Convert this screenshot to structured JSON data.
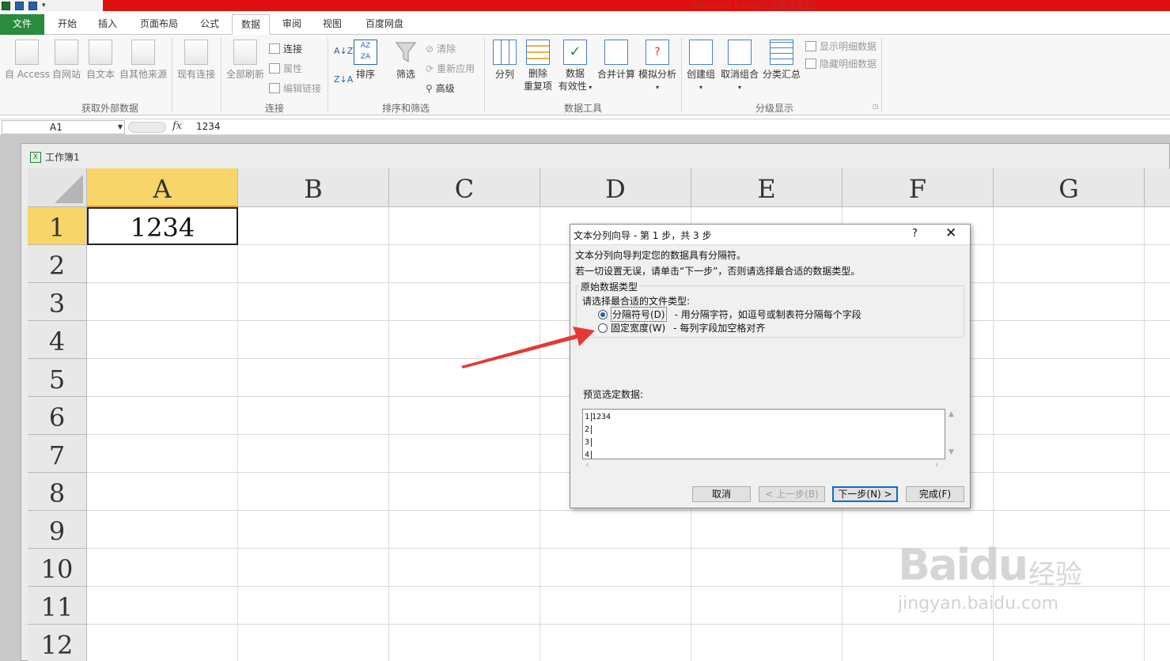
{
  "window": {
    "title": "Microsoft Excel(产品激活失败)"
  },
  "tabs": [
    {
      "label": "文件"
    },
    {
      "label": "开始"
    },
    {
      "label": "插入"
    },
    {
      "label": "页面布局"
    },
    {
      "label": "公式"
    },
    {
      "label": "数据"
    },
    {
      "label": "审阅"
    },
    {
      "label": "视图"
    },
    {
      "label": "百度网盘"
    }
  ],
  "ribbon": {
    "external": {
      "access": "自 Access",
      "web": "自网站",
      "text": "自文本",
      "other": "自其他来源",
      "existing": "现有连接",
      "group": "获取外部数据"
    },
    "connections": {
      "refresh_all": "全部刷新",
      "connections": "连接",
      "properties": "属性",
      "edit_links": "编辑链接",
      "group": "连接"
    },
    "sort_filter": {
      "sort": "排序",
      "filter": "筛选",
      "clear": "清除",
      "reapply": "重新应用",
      "advanced": "高级",
      "group": "排序和筛选"
    },
    "data_tools": {
      "text_to_columns": "分列",
      "remove_dup_1": "删除",
      "remove_dup_2": "重复项",
      "validation_1": "数据",
      "validation_2": "有效性",
      "consolidate": "合并计算",
      "what_if": "模拟分析",
      "group": "数据工具"
    },
    "outline": {
      "group_btn": "创建组",
      "ungroup": "取消组合",
      "subtotal": "分类汇总",
      "show_detail": "显示明细数据",
      "hide_detail": "隐藏明细数据",
      "group": "分级显示"
    }
  },
  "formula_bar": {
    "name_box": "A1",
    "fx": "fx",
    "value": "1234"
  },
  "workbook": {
    "title": "工作簿1",
    "columns": [
      "A",
      "B",
      "C",
      "D",
      "E",
      "F",
      "G"
    ],
    "rows": [
      "1",
      "2",
      "3",
      "4",
      "5",
      "6",
      "7",
      "8",
      "9",
      "10",
      "11",
      "12"
    ],
    "cell_a1": "1234"
  },
  "dialog": {
    "title": "文本分列向导 - 第 1 步，共 3 步",
    "help": "?",
    "close": "✕",
    "line1": "文本分列向导判定您的数据具有分隔符。",
    "line2": "若一切设置无误，请单击“下一步”，否则请选择最合适的数据类型。",
    "group_title": "原始数据类型",
    "choose_label": "请选择最合适的文件类型:",
    "option1_label": "分隔符号(D)",
    "option1_desc": "- 用分隔字符，如逗号或制表符分隔每个字段",
    "option2_label": "固定宽度(W)",
    "option2_desc": "- 每列字段加空格对齐",
    "preview_label": "预览选定数据:",
    "preview_rows": [
      "1",
      "2",
      "3",
      "4"
    ],
    "preview_value": "1234",
    "btn_cancel": "取消",
    "btn_back": "< 上一步(B)",
    "btn_next": "下一步(N) >",
    "btn_finish": "完成(F)"
  },
  "watermark": {
    "logo": "Baidu",
    "cn": "经验",
    "url": "jingyan.baidu.com"
  },
  "colors": {
    "title_bar": "#e01010",
    "file_tab": "#2a8a3e",
    "selected_header": "#f8d568",
    "arrow": "#e53935"
  }
}
